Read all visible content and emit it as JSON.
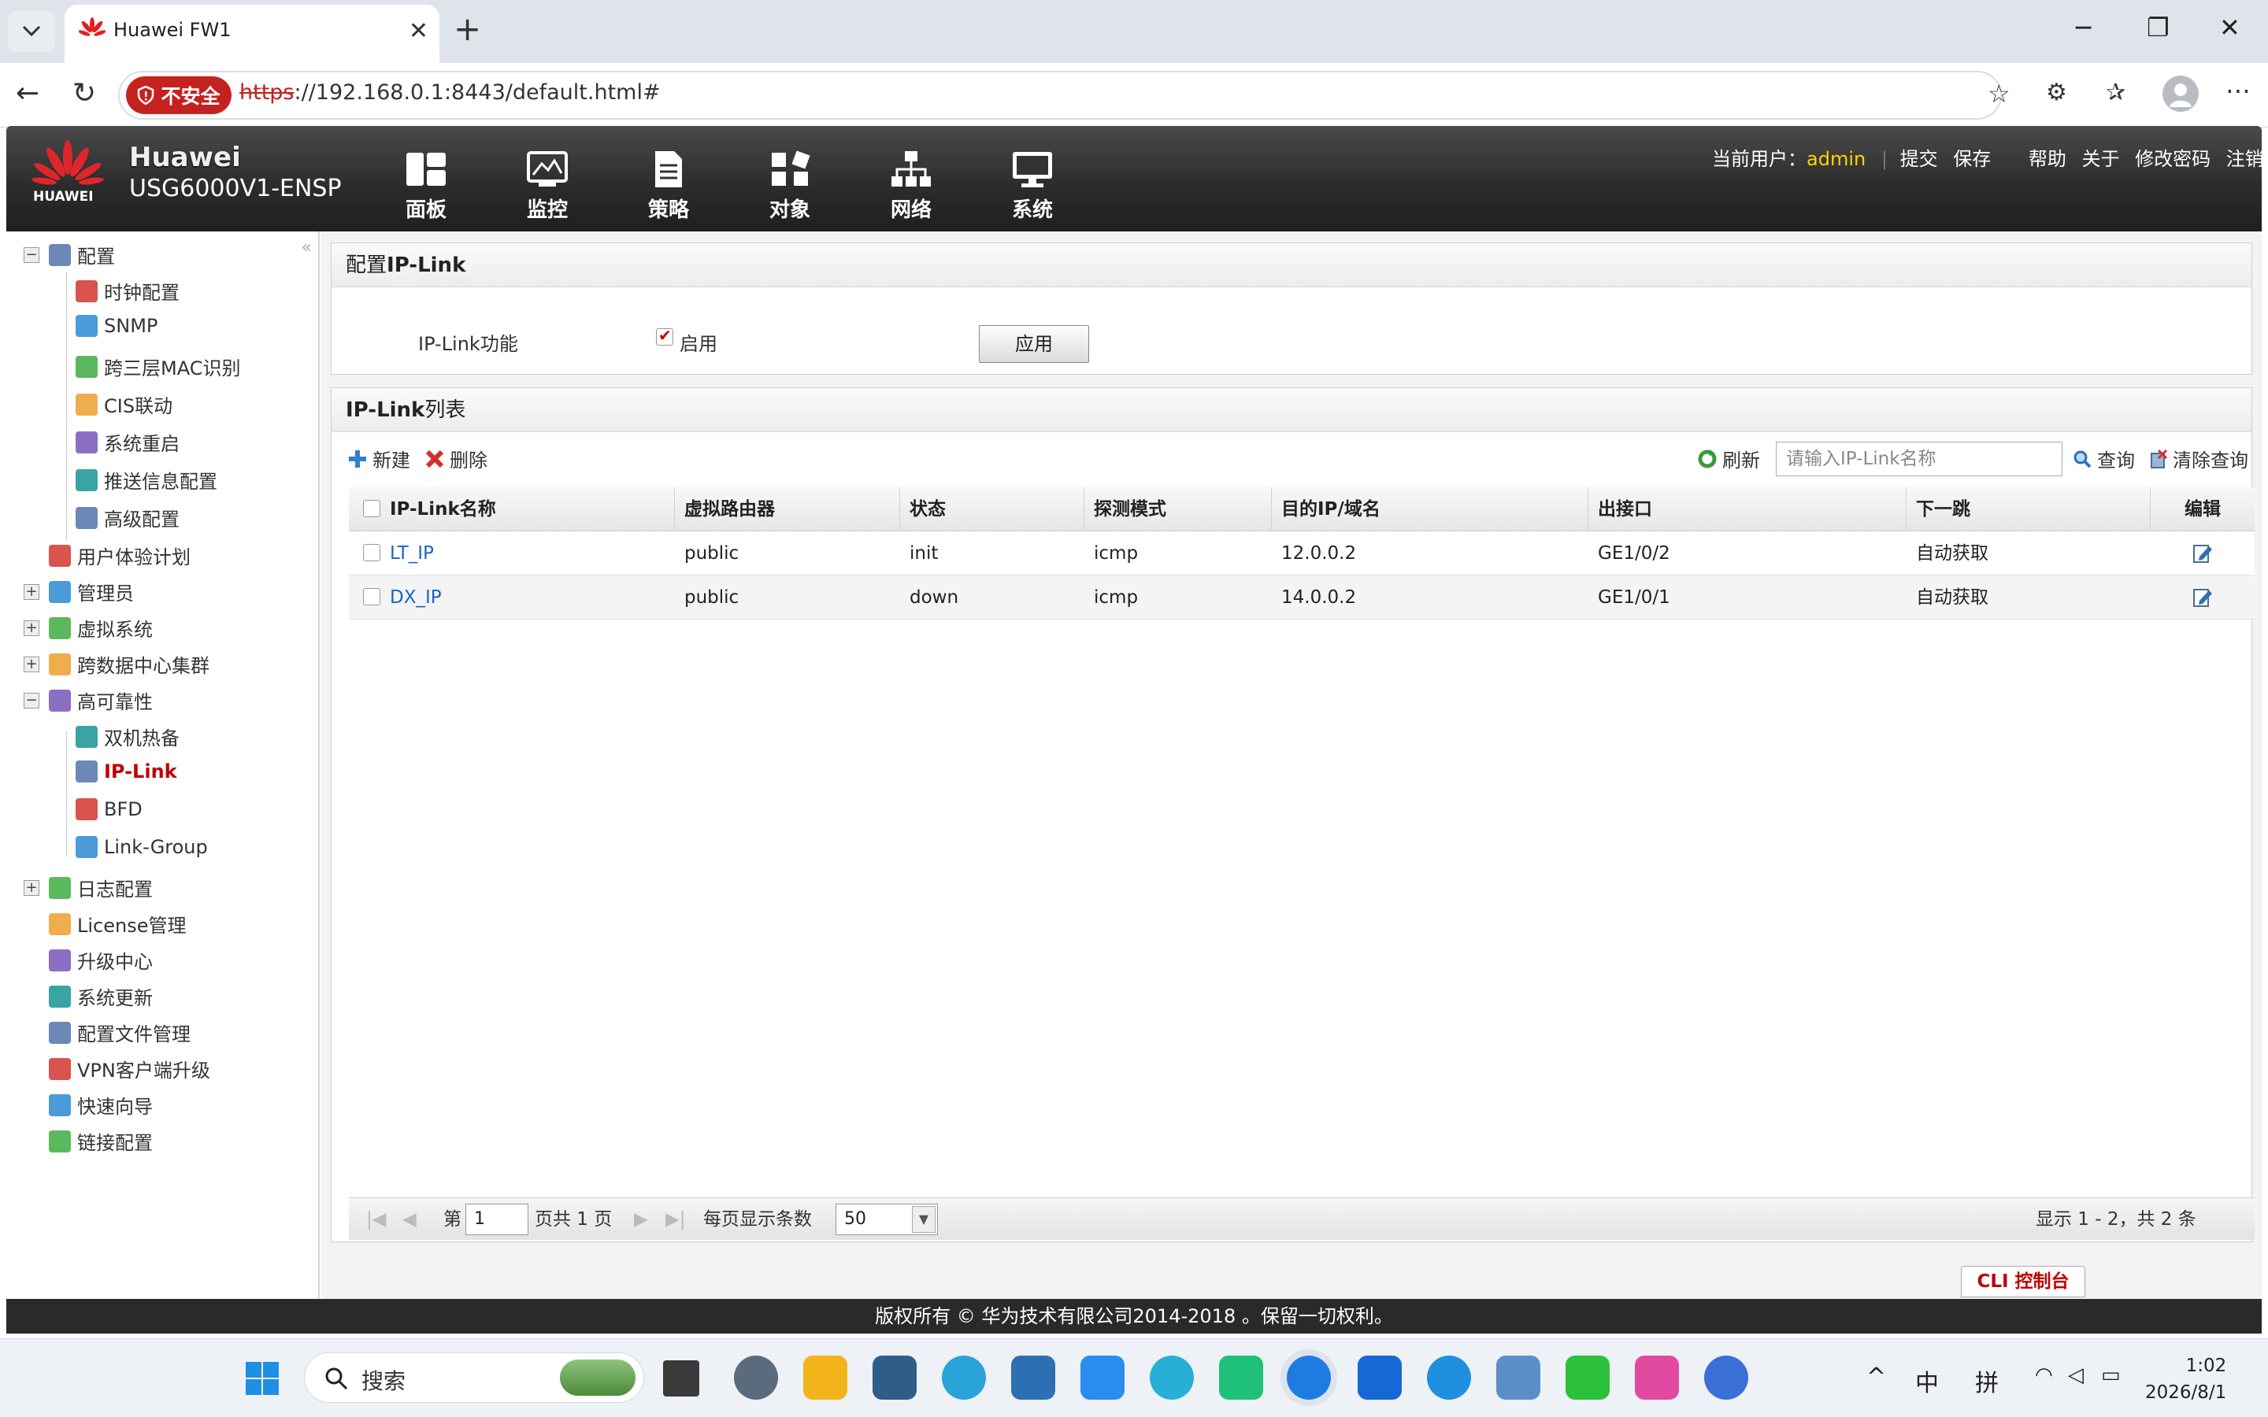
{
  "browser": {
    "tab_title": "Huawei FW1",
    "insecure_label": "不安全",
    "url_scheme": "https",
    "url_rest": "://192.168.0.1:8443/default.html#"
  },
  "app": {
    "brand_name": "Huawei",
    "model": "USG6000V1-ENSP",
    "logo_text": "HUAWEI",
    "nav": [
      "面板",
      "监控",
      "策略",
      "对象",
      "网络",
      "系统"
    ],
    "active_nav": "系统",
    "current_user_label": "当前用户：",
    "current_user": "admin",
    "header_links": [
      "提交",
      "保存",
      "帮助",
      "关于",
      "修改密码",
      "注销"
    ]
  },
  "sidebar": {
    "collapse_glyph": "«",
    "items": [
      {
        "label": "配置",
        "level": 0,
        "expander": "−",
        "icon": "config-icon"
      },
      {
        "label": "时钟配置",
        "level": 1,
        "icon": "clock-icon"
      },
      {
        "label": "SNMP",
        "level": 1,
        "icon": "snmp-icon"
      },
      {
        "label": "跨三层MAC识别",
        "level": 1,
        "icon": "mac-icon"
      },
      {
        "label": "CIS联动",
        "level": 1,
        "icon": "cis-icon"
      },
      {
        "label": "系统重启",
        "level": 1,
        "icon": "restart-icon"
      },
      {
        "label": "推送信息配置",
        "level": 1,
        "icon": "push-icon"
      },
      {
        "label": "高级配置",
        "level": 1,
        "icon": "advanced-icon"
      },
      {
        "label": "用户体验计划",
        "level": 0,
        "icon": "ux-icon"
      },
      {
        "label": "管理员",
        "level": 0,
        "expander": "+",
        "icon": "admin-icon"
      },
      {
        "label": "虚拟系统",
        "level": 0,
        "expander": "+",
        "icon": "vsys-icon"
      },
      {
        "label": "跨数据中心集群",
        "level": 0,
        "expander": "+",
        "icon": "cluster-icon"
      },
      {
        "label": "高可靠性",
        "level": 0,
        "expander": "−",
        "icon": "ha-icon"
      },
      {
        "label": "双机热备",
        "level": 1,
        "icon": "hot-standby-icon"
      },
      {
        "label": "IP-Link",
        "level": 1,
        "icon": "iplink-icon",
        "selected": true
      },
      {
        "label": "BFD",
        "level": 1,
        "icon": "bfd-icon"
      },
      {
        "label": "Link-Group",
        "level": 1,
        "icon": "link-group-icon"
      },
      {
        "label": "日志配置",
        "level": 0,
        "expander": "+",
        "icon": "log-icon"
      },
      {
        "label": "License管理",
        "level": 0,
        "icon": "license-icon"
      },
      {
        "label": "升级中心",
        "level": 0,
        "icon": "upgrade-icon"
      },
      {
        "label": "系统更新",
        "level": 0,
        "icon": "update-icon"
      },
      {
        "label": "配置文件管理",
        "level": 0,
        "icon": "config-file-icon"
      },
      {
        "label": "VPN客户端升级",
        "level": 0,
        "icon": "vpn-icon"
      },
      {
        "label": "快速向导",
        "level": 0,
        "icon": "wizard-icon"
      },
      {
        "label": "链接配置",
        "level": 0,
        "icon": "link-config-icon"
      }
    ]
  },
  "config_panel": {
    "title_prefix": "配置",
    "title_bold": "IP-Link",
    "feature_label": "IP-Link功能",
    "enable_label": "启用",
    "enabled": true,
    "apply_label": "应用"
  },
  "list_panel": {
    "title_bold": "IP-Link",
    "title_suffix": "列表",
    "new_label": "新建",
    "delete_label": "删除",
    "refresh_label": "刷新",
    "search_placeholder": "请输入IP-Link名称",
    "query_label": "查询",
    "clear_query_label": "清除查询",
    "columns": [
      "IP-Link名称",
      "虚拟路由器",
      "状态",
      "探测模式",
      "目的IP/域名",
      "出接口",
      "下一跳",
      "编辑"
    ],
    "rows": [
      [
        "LT_IP",
        "public",
        "init",
        "icmp",
        "12.0.0.2",
        "GE1/0/2",
        "自动获取"
      ],
      [
        "DX_IP",
        "public",
        "down",
        "icmp",
        "14.0.0.2",
        "GE1/0/1",
        "自动获取"
      ]
    ],
    "pager": {
      "page_prefix": "第",
      "page_value": "1",
      "page_suffix": "页共 1 页",
      "per_page_label": "每页显示条数",
      "per_page_value": "50",
      "summary": "显示 1 - 2，共 2 条"
    }
  },
  "cli_label": "CLI 控制台",
  "footer": "版权所有 © 华为技术有限公司2014-2018 。保留一切权利。",
  "taskbar": {
    "search_label": "搜索",
    "ime_lang": "中",
    "ime_mode": "拼",
    "time": "1:02",
    "date": "2026/8/1"
  },
  "colors": {
    "brand_red": "#c00000",
    "link_blue": "#1a63c8",
    "user_yellow": "#ffd200",
    "insecure_red": "#c5221f"
  }
}
